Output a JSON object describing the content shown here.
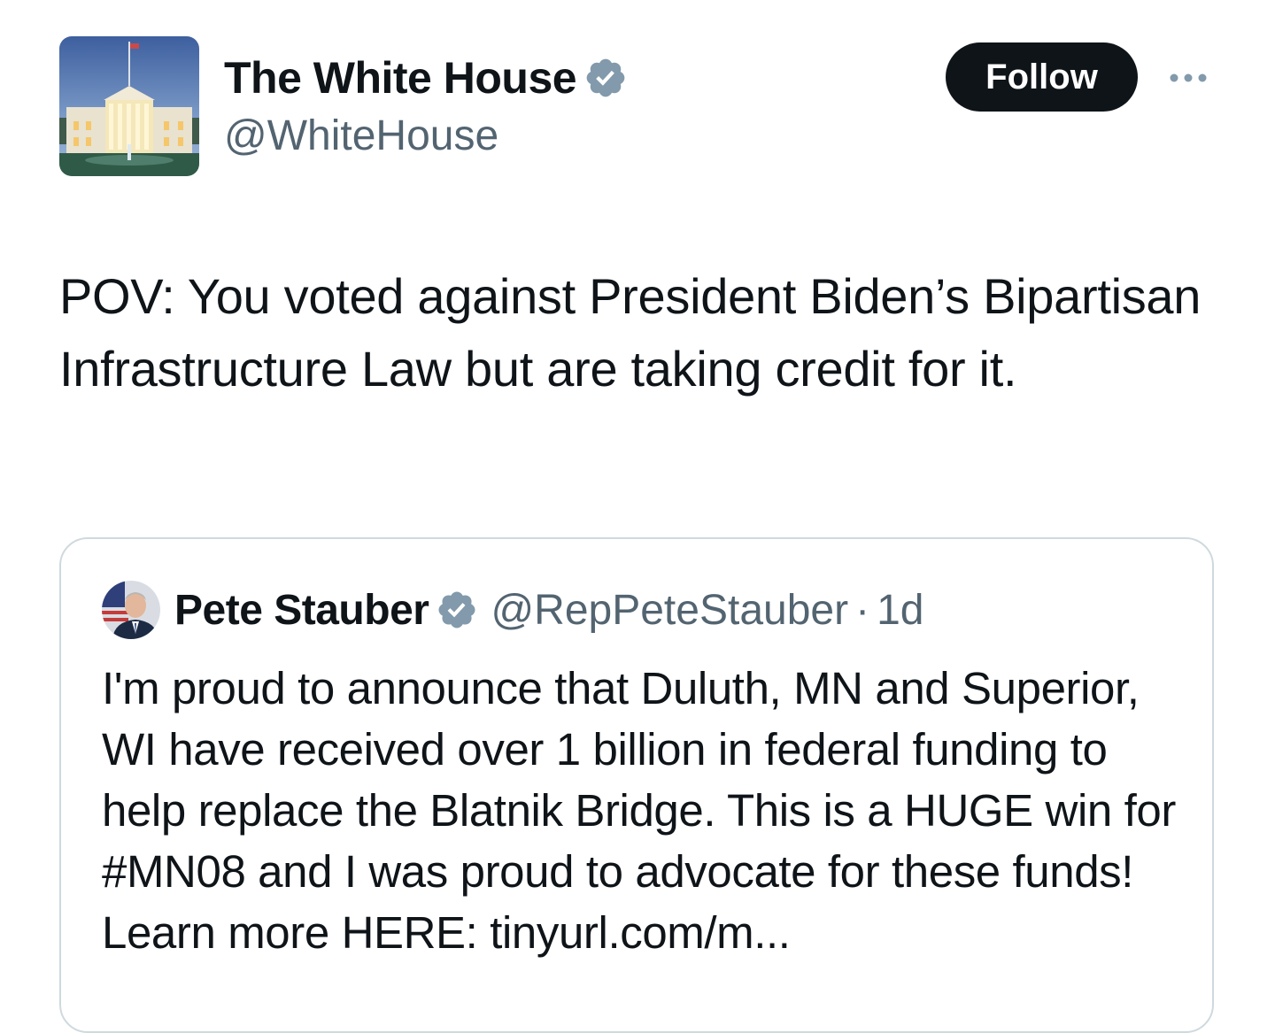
{
  "author": {
    "display_name": "The White House",
    "handle": "@WhiteHouse",
    "verified_icon": "verified-badge-gray"
  },
  "actions": {
    "follow_label": "Follow",
    "more_icon": "more-horizontal-icon"
  },
  "tweet": {
    "text": "POV: You voted against President Biden’s Bipartisan Infrastructure Law but are taking credit for it."
  },
  "quote": {
    "display_name": "Pete Stauber",
    "handle": "@RepPeteStauber",
    "separator": "·",
    "time": "1d",
    "text": "I'm proud to announce that Duluth, MN and Superior, WI have received over 1 billion in federal funding to help replace the Blatnik Bridge. This is a HUGE win for #MN08 and I was proud to advocate for these funds! Learn more HERE: tinyurl.com/m..."
  },
  "colors": {
    "text_primary": "#0f1419",
    "text_secondary": "#536471",
    "follow_bg": "#0f1419",
    "border": "#cfd9de",
    "verified_gray": "#829aab"
  }
}
